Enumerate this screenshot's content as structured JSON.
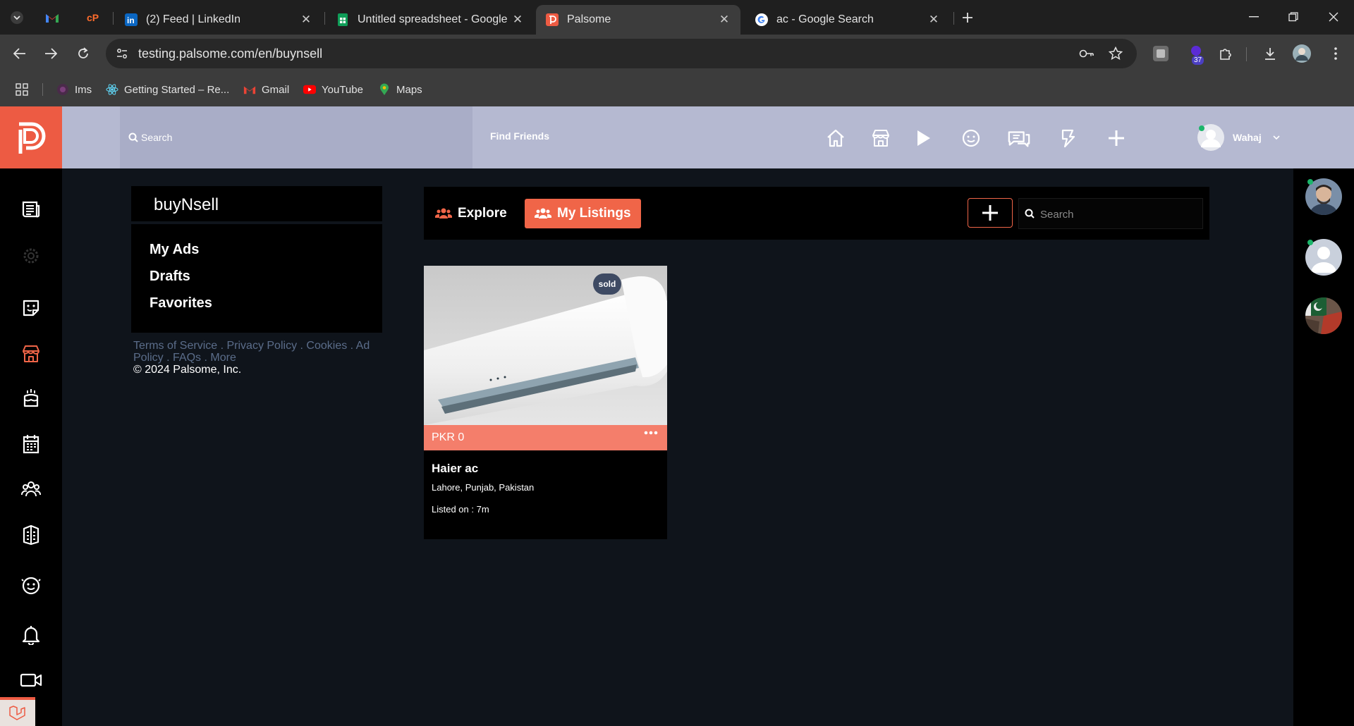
{
  "browser": {
    "tabs": [
      {
        "title": "(2) Feed | LinkedIn"
      },
      {
        "title": "Untitled spreadsheet - Google Sheets"
      },
      {
        "title": "Palsome",
        "active": true
      },
      {
        "title": "ac - Google Search"
      }
    ],
    "url": "testing.palsome.com/en/buynsell",
    "extension_badge": "37",
    "bookmarks": [
      {
        "label": "Ims"
      },
      {
        "label": "Getting Started – Re..."
      },
      {
        "label": "Gmail"
      },
      {
        "label": "YouTube"
      },
      {
        "label": "Maps"
      }
    ]
  },
  "header": {
    "search_placeholder": "Search",
    "find_friends": "Find Friends",
    "user_name": "Wahaj"
  },
  "left_panel": {
    "title": "buyNsell",
    "menu": [
      "My Ads",
      "Drafts",
      "Favorites"
    ],
    "footer": {
      "terms": "Terms of Service",
      "privacy": "Privacy Policy",
      "cookies": "Cookies",
      "ad_policy": "Ad Policy",
      "faqs": "FAQs",
      "more": "More",
      "copyright": "© 2024 Palsome, Inc."
    }
  },
  "toolbar": {
    "explore": "Explore",
    "my_listings": "My Listings",
    "search_placeholder": "Search"
  },
  "listing": {
    "badge": "sold",
    "price": "PKR 0",
    "title": "Haier ac",
    "location": "Lahore, Punjab, Pakistan",
    "listed": "Listed on : 7m"
  },
  "colors": {
    "accent": "#f06548",
    "header_bg": "#b5b9d1",
    "logo_bg": "#ed5b43",
    "price_bar": "#f47e6b",
    "online": "#1bb56a"
  }
}
